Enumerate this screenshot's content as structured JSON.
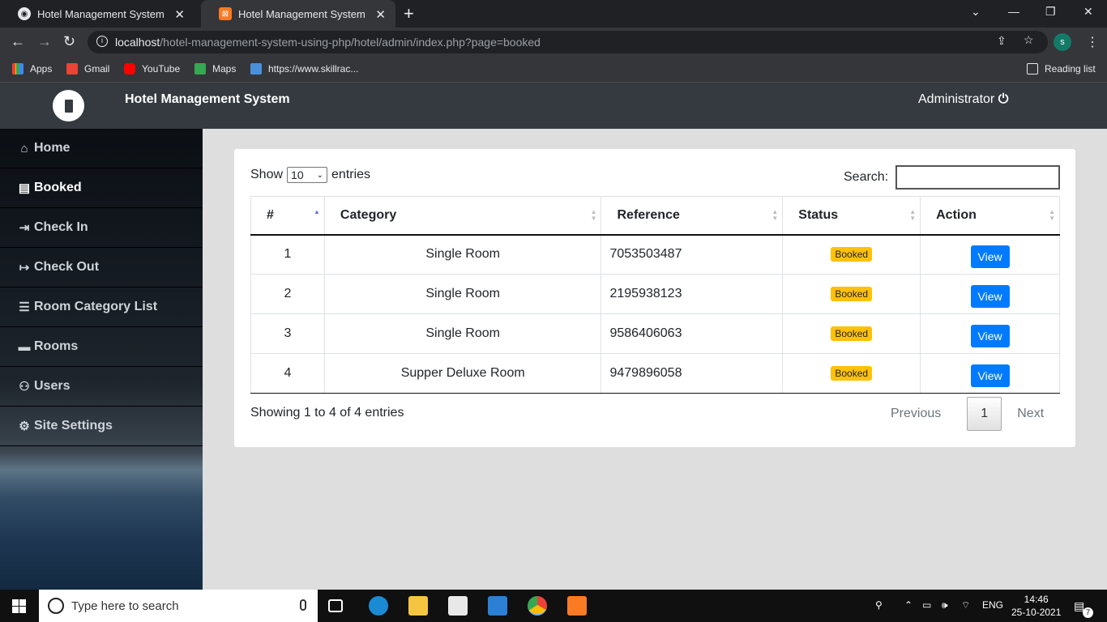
{
  "browser": {
    "tabs": [
      {
        "title": "Hotel Management System"
      },
      {
        "title": "Hotel Management System"
      }
    ],
    "url_host": "localhost",
    "url_path": "/hotel-management-system-using-php/hotel/admin/index.php?page=booked",
    "profile_initial": "s",
    "bookmarks": [
      "Apps",
      "Gmail",
      "YouTube",
      "Maps",
      "https://www.skillrac..."
    ],
    "reading_list": "Reading list"
  },
  "header": {
    "title": "Hotel Management System",
    "user": "Administrator"
  },
  "sidebar": {
    "items": [
      {
        "label": "Home",
        "icon": "home-icon"
      },
      {
        "label": "Booked",
        "icon": "book-icon"
      },
      {
        "label": "Check In",
        "icon": "sign-in-icon"
      },
      {
        "label": "Check Out",
        "icon": "sign-out-icon"
      },
      {
        "label": "Room Category List",
        "icon": "list-icon"
      },
      {
        "label": "Rooms",
        "icon": "bed-icon"
      },
      {
        "label": "Users",
        "icon": "users-icon"
      },
      {
        "label": "Site Settings",
        "icon": "cogs-icon"
      }
    ],
    "active": "Booked"
  },
  "table_controls": {
    "show_label": "Show",
    "entries_value": "10",
    "entries_label": "entries",
    "search_label": "Search:",
    "search_value": ""
  },
  "table": {
    "headers": [
      "#",
      "Category",
      "Reference",
      "Status",
      "Action"
    ],
    "rows": [
      {
        "num": "1",
        "category": "Single Room",
        "reference": "7053503487",
        "status": "Booked",
        "action": "View"
      },
      {
        "num": "2",
        "category": "Single Room",
        "reference": "2195938123",
        "status": "Booked",
        "action": "View"
      },
      {
        "num": "3",
        "category": "Single Room",
        "reference": "9586406063",
        "status": "Booked",
        "action": "View"
      },
      {
        "num": "4",
        "category": "Supper Deluxe Room",
        "reference": "9479896058",
        "status": "Booked",
        "action": "View"
      }
    ]
  },
  "footer": {
    "info": "Showing 1 to 4 of 4 entries",
    "previous": "Previous",
    "page": "1",
    "next": "Next"
  },
  "taskbar": {
    "search_placeholder": "Type here to search",
    "lang": "ENG",
    "time": "14:46",
    "date": "25-10-2021",
    "notification_count": "7"
  },
  "colors": {
    "header_bg": "#343a40",
    "badge": "#ffc107",
    "button": "#007bff"
  }
}
